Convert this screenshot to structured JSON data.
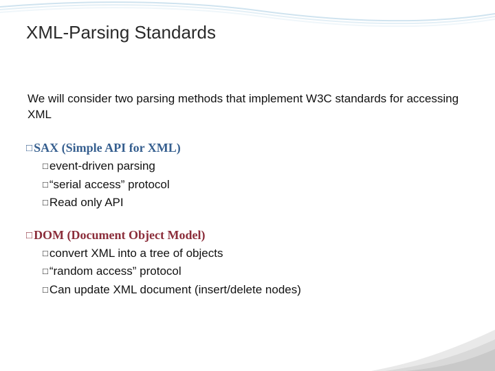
{
  "title": "XML-Parsing Standards",
  "intro": "We will consider two parsing methods that implement W3C standards for accessing XML",
  "sections": [
    {
      "heading": "SAX (Simple API for XML)",
      "colorClass": "blue",
      "items": [
        "event-driven parsing",
        "“serial access” protocol",
        "Read only API"
      ]
    },
    {
      "heading": "DOM (Document Object Model)",
      "colorClass": "maroon",
      "items": [
        "convert XML into a tree of objects",
        "“random access” protocol",
        "Can update XML document (insert/delete nodes)"
      ]
    }
  ],
  "bullets": {
    "square": "□"
  }
}
